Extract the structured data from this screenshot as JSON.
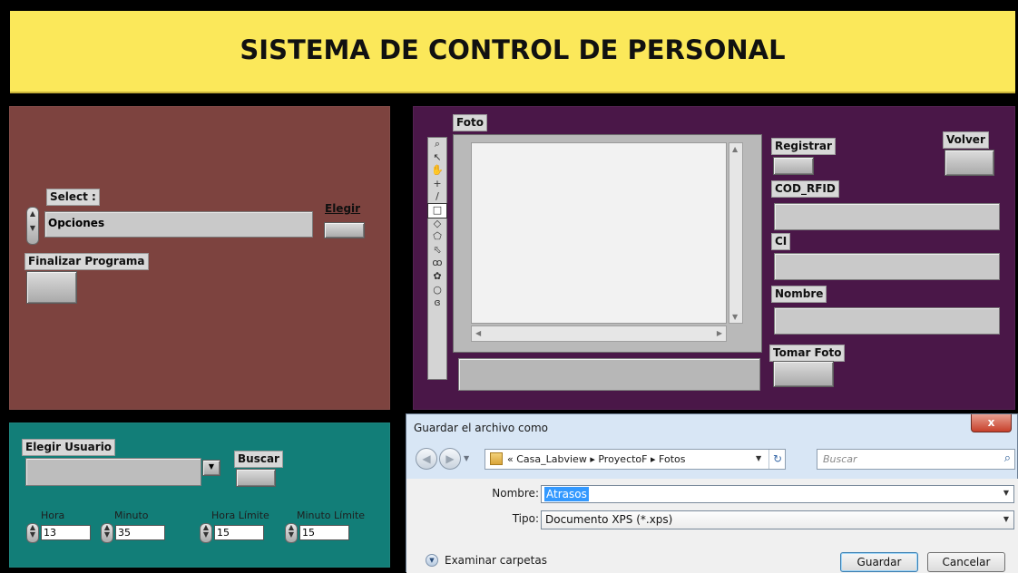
{
  "title": "SISTEMA DE CONTROL DE PERSONAL",
  "left_panel": {
    "select_label": "Select :",
    "select_value": "Opciones",
    "elegir_label": "Elegir",
    "finalizar_label": "Finalizar Programa"
  },
  "right_panel": {
    "foto_label": "Foto",
    "registrar_label": "Registrar",
    "volver_label": "Volver",
    "cod_rfid_label": "COD_RFID",
    "ci_label": "CI",
    "nombre_label": "Nombre",
    "tomar_foto_label": "Tomar Foto",
    "tools": [
      "zoom-icon",
      "arrow-icon",
      "hand-icon",
      "crosshair-icon",
      "line-icon",
      "rectangle-icon",
      "diamond-icon",
      "polygon-icon",
      "freehand-polygon-icon",
      "lasso-icon",
      "blob-icon",
      "circle-icon",
      "spiral-icon"
    ],
    "tool_glyphs": [
      "⌕",
      "↖",
      "✋",
      "+",
      "/",
      "□",
      "◇",
      "⬠",
      "⬁",
      "ꝏ",
      "✿",
      "○",
      "ɞ"
    ]
  },
  "bottom_panel": {
    "elegir_usuario_label": "Elegir Usuario",
    "buscar_label": "Buscar",
    "hora_label": "Hora",
    "hora_value": "13",
    "minuto_label": "Minuto",
    "minuto_value": "35",
    "hora_limite_label": "Hora Límite",
    "hora_limite_value": "15",
    "minuto_limite_label": "Minuto Límite",
    "minuto_limite_value": "15"
  },
  "dialog": {
    "title": "Guardar el archivo como",
    "close_glyph": "x",
    "path": [
      "Casa_Labview",
      "ProyectoF",
      "Fotos"
    ],
    "path_prefix": "«",
    "path_sep": "▸",
    "search_placeholder": "Buscar",
    "nombre_label": "Nombre:",
    "nombre_value": "Atrasos",
    "tipo_label": "Tipo:",
    "tipo_value": "Documento XPS (*.xps)",
    "examinar_label": "Examinar carpetas",
    "guardar_label": "Guardar",
    "cancelar_label": "Cancelar"
  },
  "colors": {
    "title_bg": "#fbe85a",
    "left_panel": "#7d433f",
    "right_panel": "#4a1748",
    "bottom_panel": "#127e78",
    "dialog_chrome": "#d8e6f5"
  }
}
